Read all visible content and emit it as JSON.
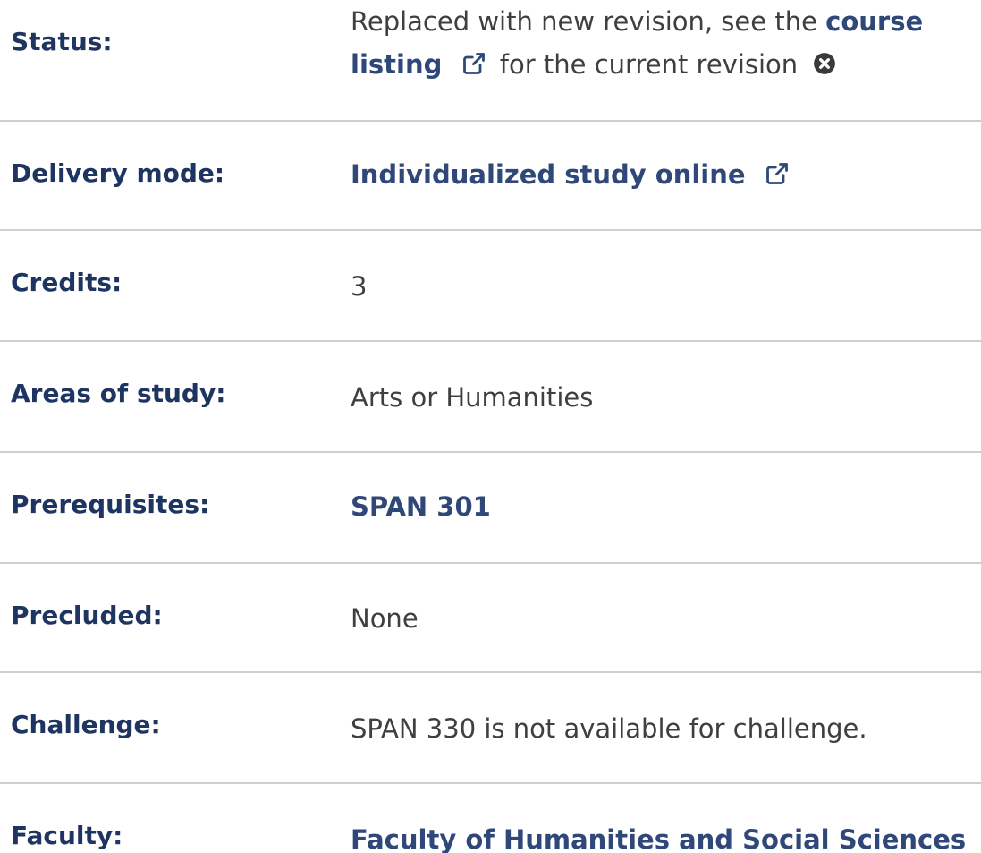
{
  "rows": {
    "status": {
      "label": "Status:",
      "text_before": "Replaced with new revision, see the ",
      "link_line1": "course",
      "link_line2": "listing",
      "text_after": " for the current revision"
    },
    "delivery": {
      "label": "Delivery mode:",
      "link": "Individualized study online"
    },
    "credits": {
      "label": "Credits:",
      "value": "3"
    },
    "areas": {
      "label": "Areas of study:",
      "value": "Arts or Humanities"
    },
    "prereq": {
      "label": "Prerequisites:",
      "link": "SPAN 301"
    },
    "precluded": {
      "label": "Precluded:",
      "value": "None"
    },
    "challenge": {
      "label": "Challenge:",
      "value": "SPAN 330 is not available for challenge."
    },
    "faculty": {
      "label": "Faculty:",
      "link": "Faculty of Humanities and Social Sciences"
    }
  },
  "icons": {
    "external": "external-link-icon",
    "close": "close-circle-icon"
  },
  "colors": {
    "label": "#1f3561",
    "link": "#2f4879",
    "text": "#3f3f3f",
    "divider": "#cfcfcf"
  }
}
